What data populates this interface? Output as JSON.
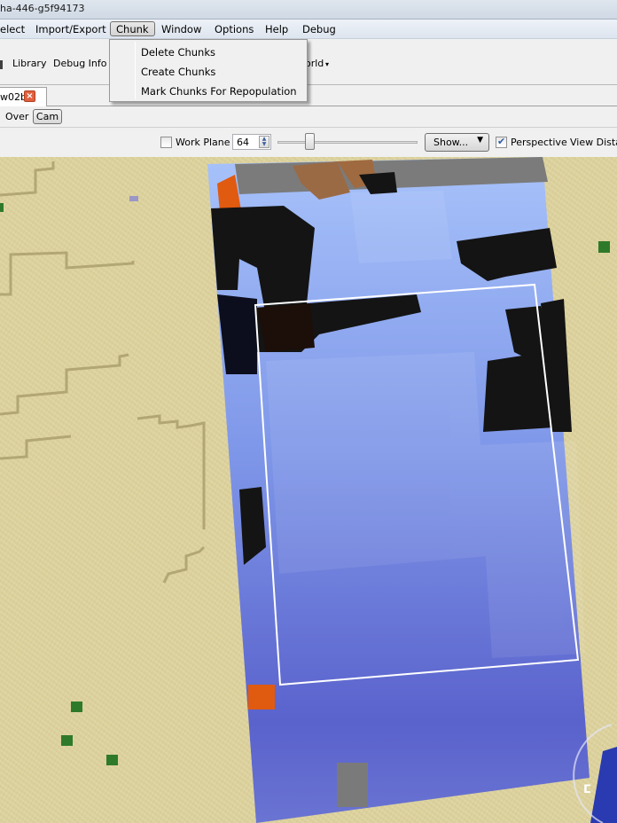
{
  "window": {
    "title": "ha-446-g5f94173"
  },
  "menubar": {
    "items": [
      {
        "label": "elect"
      },
      {
        "label": "Import/Export"
      },
      {
        "label": "Chunk",
        "active": true
      },
      {
        "label": "Window"
      },
      {
        "label": "Options"
      },
      {
        "label": "Help"
      },
      {
        "label": "Debug"
      }
    ]
  },
  "chunk_menu": {
    "items": [
      {
        "label": "Delete Chunks"
      },
      {
        "label": "Create Chunks"
      },
      {
        "label": "Mark Chunks For Repopulation"
      }
    ]
  },
  "toolbar": {
    "items": [
      {
        "label": "Library"
      },
      {
        "label": "Debug Info"
      },
      {
        "label": "orld"
      }
    ]
  },
  "tabs": [
    {
      "label": "w02b",
      "close_icon": "close-icon"
    }
  ],
  "view_row": {
    "over_label": "Over",
    "cam_label": "Cam"
  },
  "controls": {
    "work_plane_label": "Work Plane",
    "work_plane_checked": false,
    "work_plane_value": "64",
    "slider_value_fraction": 0.23,
    "show_label": "Show...",
    "perspective_label": "Perspective",
    "perspective_checked": true,
    "view_distance_label": "View Distar"
  },
  "viewport": {
    "compass_icon": "compass-icon",
    "colors": {
      "sand": "#dbd09b",
      "water_light": "#9db5f5",
      "water_deep": "#5560c8",
      "stone": "#7a7a7a",
      "lava": "#e05a10",
      "selection": "#ffffff"
    }
  }
}
